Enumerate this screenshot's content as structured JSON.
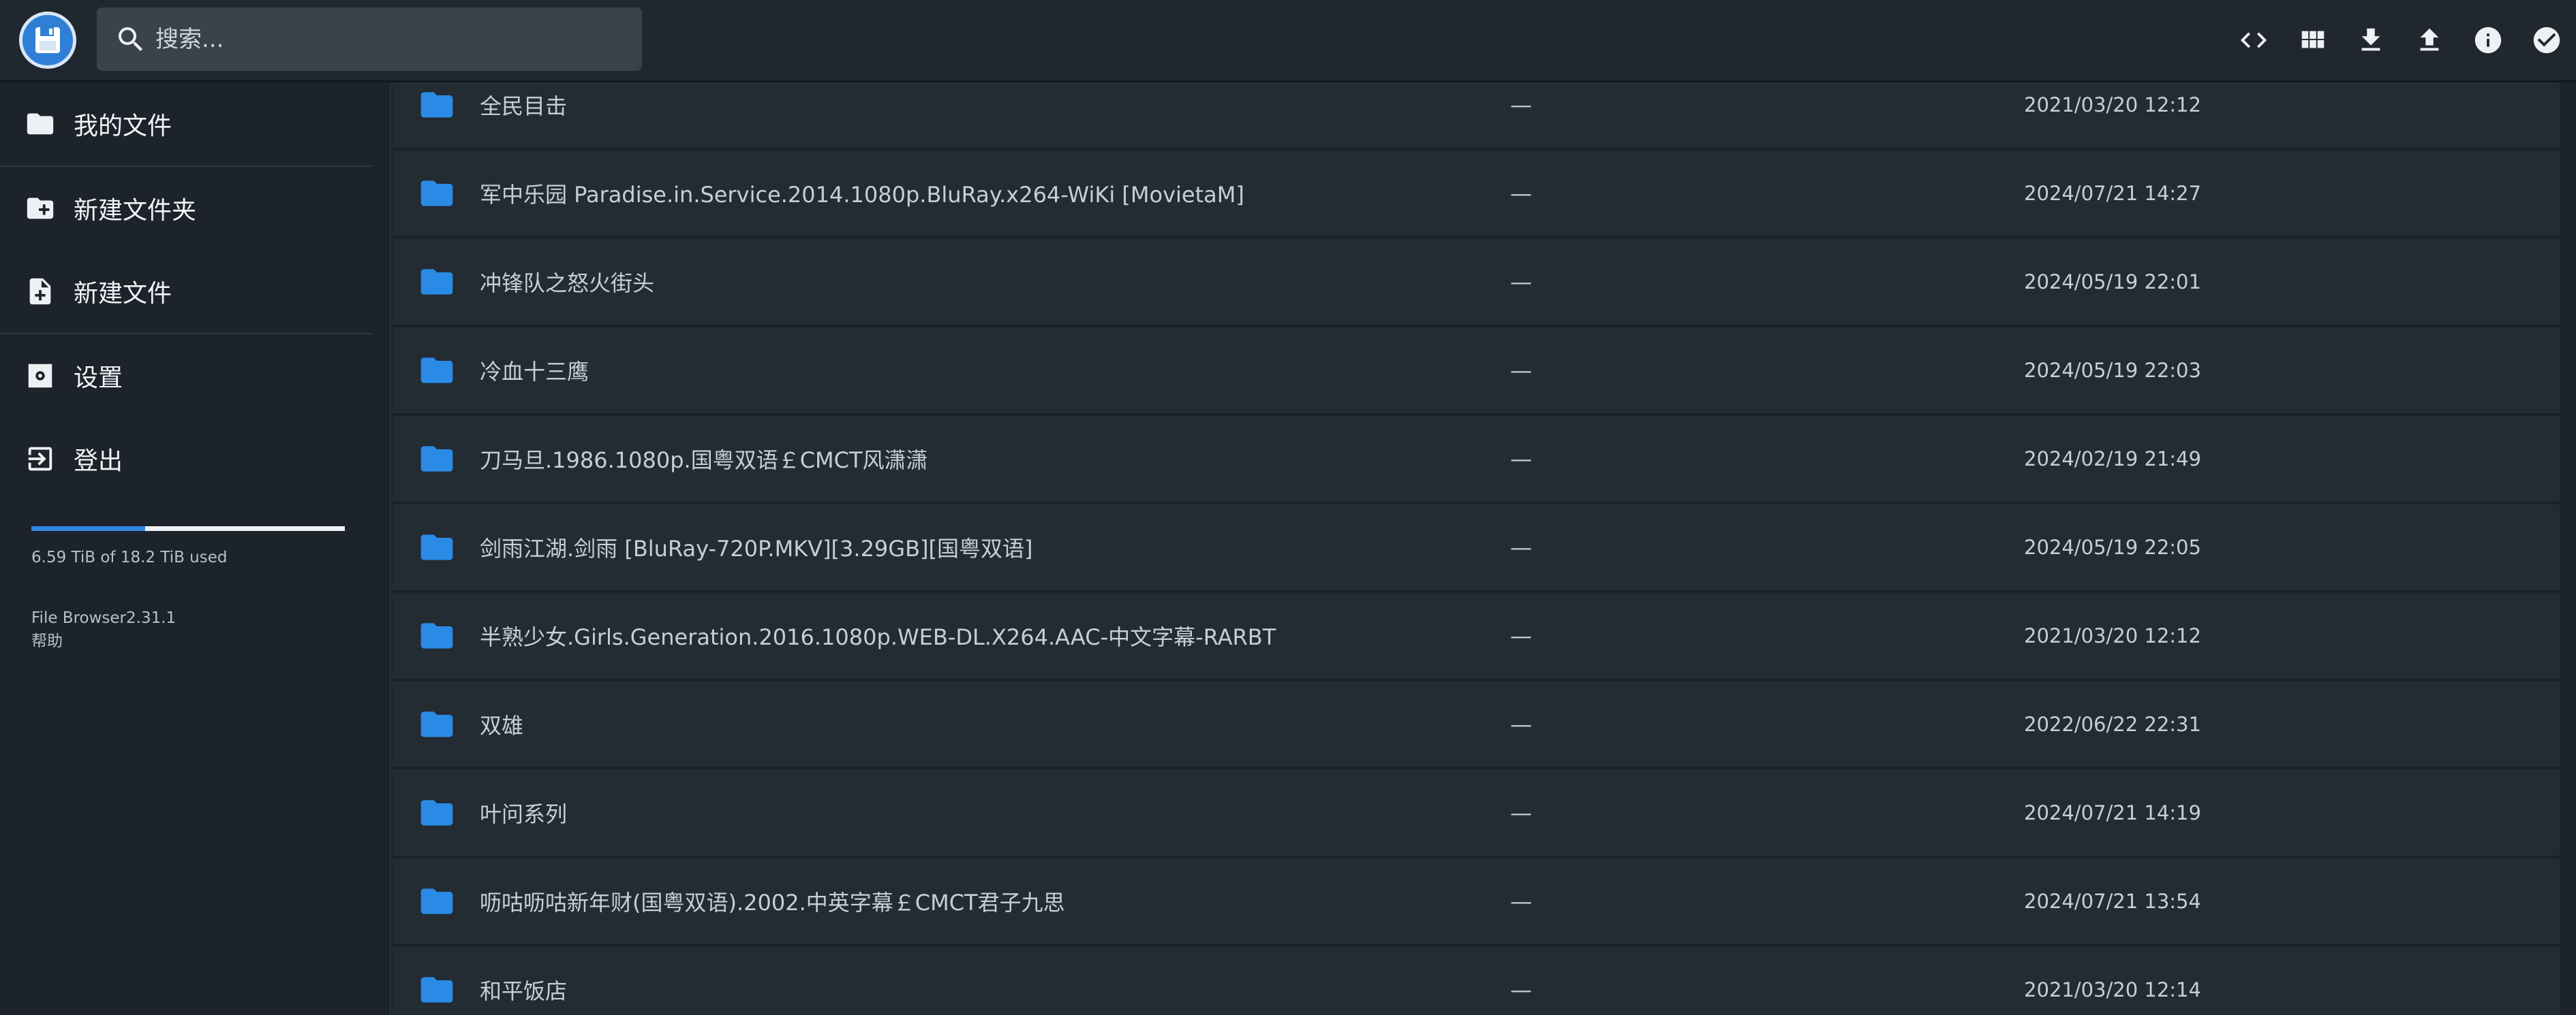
{
  "search": {
    "placeholder": "搜索..."
  },
  "toolbar": {
    "buttons": [
      {
        "icon": "code-icon"
      },
      {
        "icon": "grid-view-icon"
      },
      {
        "icon": "download-icon"
      },
      {
        "icon": "upload-icon"
      },
      {
        "icon": "info-icon"
      },
      {
        "icon": "check-circle-icon"
      }
    ]
  },
  "sidebar": {
    "items": [
      {
        "label": "我的文件",
        "icon": "folder-icon"
      },
      {
        "label": "新建文件夹",
        "icon": "folder-add-icon"
      },
      {
        "label": "新建文件",
        "icon": "file-add-icon"
      },
      {
        "label": "设置",
        "icon": "settings-icon"
      },
      {
        "label": "登出",
        "icon": "logout-icon"
      }
    ],
    "quota": {
      "used_fraction": 0.362,
      "text": "6.59 TiB of 18.2 TiB used"
    },
    "credits": {
      "app": "File Browser",
      "version": "2.31.1",
      "help": "帮助"
    }
  },
  "listing": {
    "rows": [
      {
        "name": "全民目击",
        "size": "—",
        "modified": "2021/03/20 12:12"
      },
      {
        "name": "军中乐园 Paradise.in.Service.2014.1080p.BluRay.x264-WiKi [MovietaM]",
        "size": "—",
        "modified": "2024/07/21 14:27"
      },
      {
        "name": "冲锋队之怒火街头",
        "size": "—",
        "modified": "2024/05/19 22:01"
      },
      {
        "name": "冷血十三鹰",
        "size": "—",
        "modified": "2024/05/19 22:03"
      },
      {
        "name": "刀马旦.1986.1080p.国粤双语￡CMCT风潇潇",
        "size": "—",
        "modified": "2024/02/19 21:49"
      },
      {
        "name": "剑雨江湖.剑雨 [BluRay-720P.MKV][3.29GB][国粤双语]",
        "size": "—",
        "modified": "2024/05/19 22:05"
      },
      {
        "name": "半熟少女.Girls.Generation.2016.1080p.WEB-DL.X264.AAC-中文字幕-RARBT",
        "size": "—",
        "modified": "2021/03/20 12:12"
      },
      {
        "name": "双雄",
        "size": "—",
        "modified": "2022/06/22 22:31"
      },
      {
        "name": "叶问系列",
        "size": "—",
        "modified": "2024/07/21 14:19"
      },
      {
        "name": "呖咕呖咕新年财(国粤双语).2002.中英字幕￡CMCT君子九思",
        "size": "—",
        "modified": "2024/07/21 13:54"
      },
      {
        "name": "和平饭店",
        "size": "—",
        "modified": "2021/03/20 12:14"
      }
    ]
  }
}
